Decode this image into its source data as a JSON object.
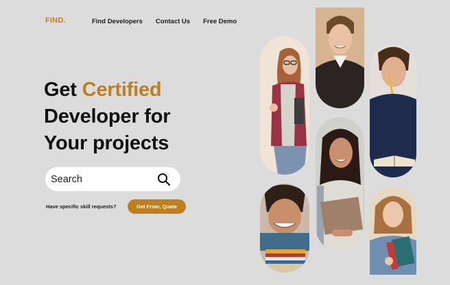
{
  "header": {
    "logo": "FIND.",
    "nav": [
      "Find Developers",
      "Contact Us",
      "Free Demo"
    ]
  },
  "hero": {
    "line1_prefix": "Get ",
    "line1_accent": "Certified",
    "line2": "Developer for",
    "line3": "Your projects"
  },
  "search": {
    "placeholder": "Search",
    "icon": "search-icon"
  },
  "request": {
    "label": "Have specific skill requests?",
    "button": "Get From, Quate"
  },
  "colors": {
    "accent": "#c07f1f",
    "background": "#dcdcdc"
  },
  "gallery": [
    "photo-woman-glasses-books",
    "photo-young-man-smiling",
    "photo-man-with-pencil",
    "photo-man-leaning-on-books",
    "photo-woman-holding-folder",
    "photo-girl-holding-books"
  ]
}
